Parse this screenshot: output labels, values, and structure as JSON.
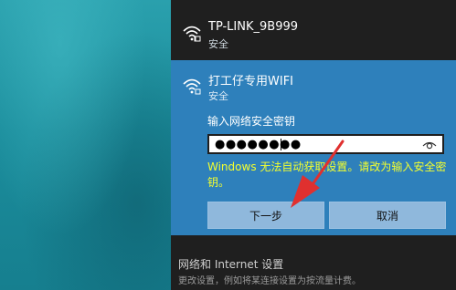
{
  "networks": [
    {
      "ssid": "TP-LINK_9B999",
      "security": "安全",
      "icon": "wifi-icon"
    },
    {
      "ssid": "打工仔专用WIFI",
      "security": "安全",
      "icon": "wifi-icon"
    }
  ],
  "connect": {
    "password_label": "输入网络安全密钥",
    "password_value": "●●●●●●●●",
    "reveal_icon": "eye-icon",
    "warning": "Windows 无法自动获取设置。请改为输入安全密钥。",
    "next_label": "下一步",
    "cancel_label": "取消"
  },
  "settings": {
    "title": "网络和 Internet 设置",
    "subtitle": "更改设置，例如将某连接设置为按流量计费。"
  },
  "colors": {
    "flyout_bg": "#1f1f1f",
    "selected_bg": "#2e80bb",
    "warning": "#f4ff2e",
    "button_bg": "#8fb8dc",
    "annotation_arrow": "#e0302f"
  }
}
